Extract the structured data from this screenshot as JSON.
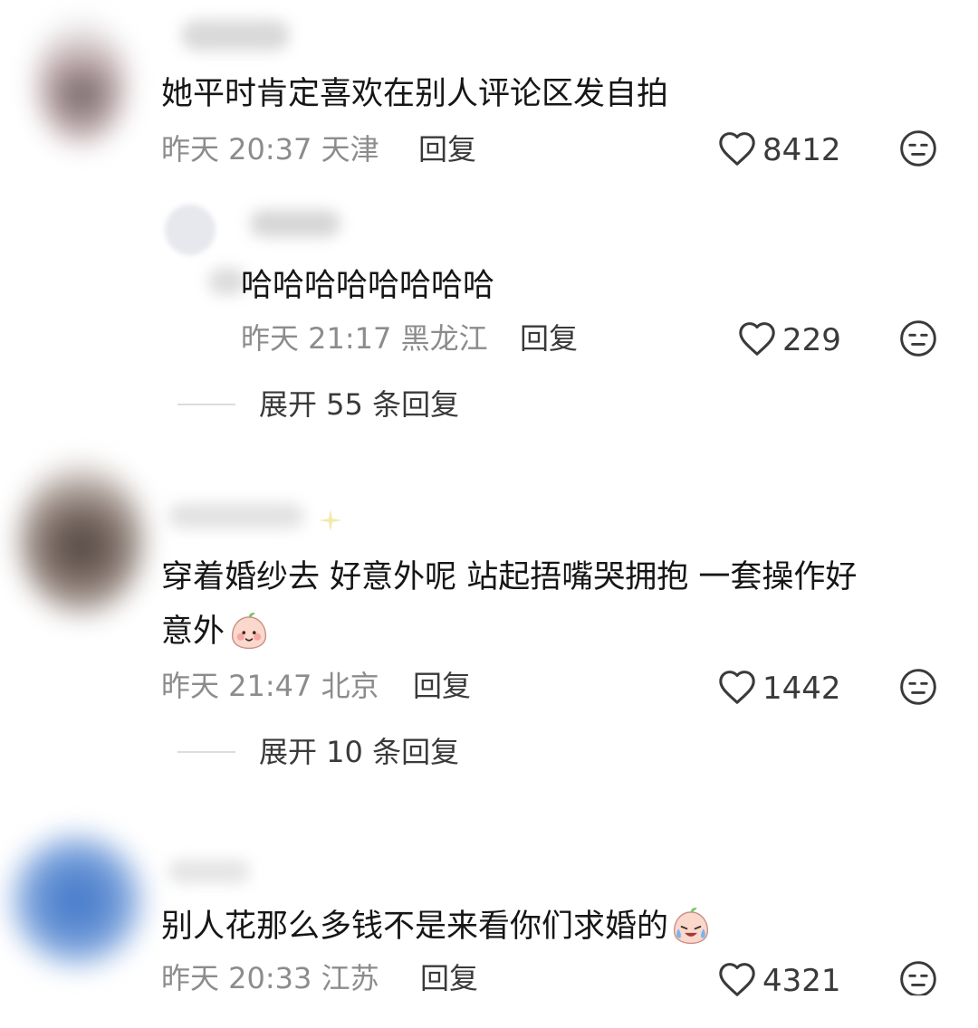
{
  "comments": [
    {
      "text": "她平时肯定喜欢在别人评论区发自拍",
      "meta": "昨天 20:37 天津",
      "reply_label": "回复",
      "likes": "8412",
      "replies": [
        {
          "text": "哈哈哈哈哈哈哈哈",
          "meta": "昨天 21:17 黑龙江",
          "reply_label": "回复",
          "likes": "229"
        }
      ],
      "expand_label": "展开 55 条回复"
    },
    {
      "text_line1": "穿着婚纱去 好意外呢 站起捂嘴哭拥抱 一套操作好",
      "text_line2": "意外",
      "emoji": "smiling-peach-emoji",
      "meta": "昨天 21:47 北京",
      "reply_label": "回复",
      "likes": "1442",
      "expand_label": "展开 10 条回复"
    },
    {
      "text": "别人花那么多钱不是来看你们求婚的",
      "emoji": "crying-laughing-peach-emoji",
      "meta": "昨天 20:33 江苏",
      "reply_label": "回复",
      "likes": "4321"
    }
  ],
  "icons": {
    "like": "heart-outline-icon",
    "dislike": "neutral-face-icon"
  },
  "colors": {
    "meta": "#8c8c8c",
    "text": "#161616",
    "icon": "#3a3a3a"
  }
}
